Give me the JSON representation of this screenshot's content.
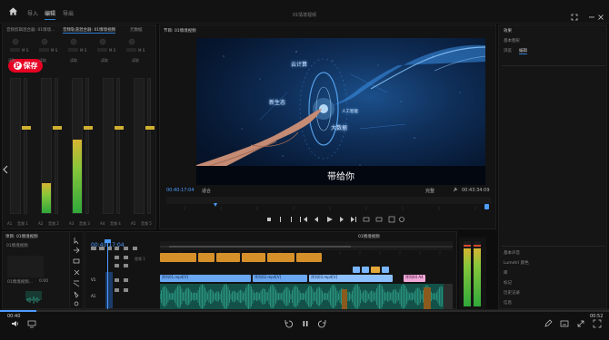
{
  "app": {
    "title": "01情境视频"
  },
  "topbar": {
    "tabs": [
      "导入",
      "编辑",
      "导出"
    ],
    "active_tab": 1
  },
  "mixer": {
    "tabs": [
      "音频剪辑混合器: 01情境...",
      "音频轨道混合器: 01情境视频",
      "元数据"
    ],
    "channels": [
      "A1",
      "A2",
      "A3",
      "A4",
      "A5"
    ],
    "channel_labels": [
      "音频 1",
      "音频 2",
      "音频 3",
      "音频 4",
      "音频 5"
    ],
    "read_label": "读取",
    "levels": [
      0.0,
      0.22,
      0.55,
      0.0,
      0.0
    ]
  },
  "pin_button": {
    "label": "保存",
    "color": "#e60023"
  },
  "program": {
    "header": "节目: 01情境视频",
    "subtitle": "带给你",
    "timecode_left": "00:40:17:04",
    "fit_label": "适合",
    "quality": "完整",
    "timecode_right": "00:43:34:09",
    "video_words": [
      "大数据",
      "新生态",
      "云计算",
      "人工智能"
    ]
  },
  "project": {
    "tabs": [
      "项目: 01情境视频",
      "01情境视频"
    ],
    "item_label": "01情境视频...",
    "item_time": "0:00"
  },
  "timeline": {
    "header": "01情境视频",
    "timecode": "00:40:17:04",
    "tracks": [
      "V1",
      "A1",
      "A2"
    ],
    "clip_labels": [
      "序列01.mp4[V]",
      "序列02.mp4[V]",
      "序列03.mp4[V]",
      "序列04 A4"
    ],
    "track_name": "视频 1"
  },
  "right_panel": {
    "tab": "效果",
    "items": [
      "基本图形",
      "浏览",
      "编辑"
    ],
    "lower_items": [
      "基本声音",
      "Lumetri 颜色",
      "库",
      "标记",
      "历史记录",
      "信息"
    ]
  },
  "bottombar": {
    "left_time": "00:40",
    "right_time": "00:52"
  }
}
